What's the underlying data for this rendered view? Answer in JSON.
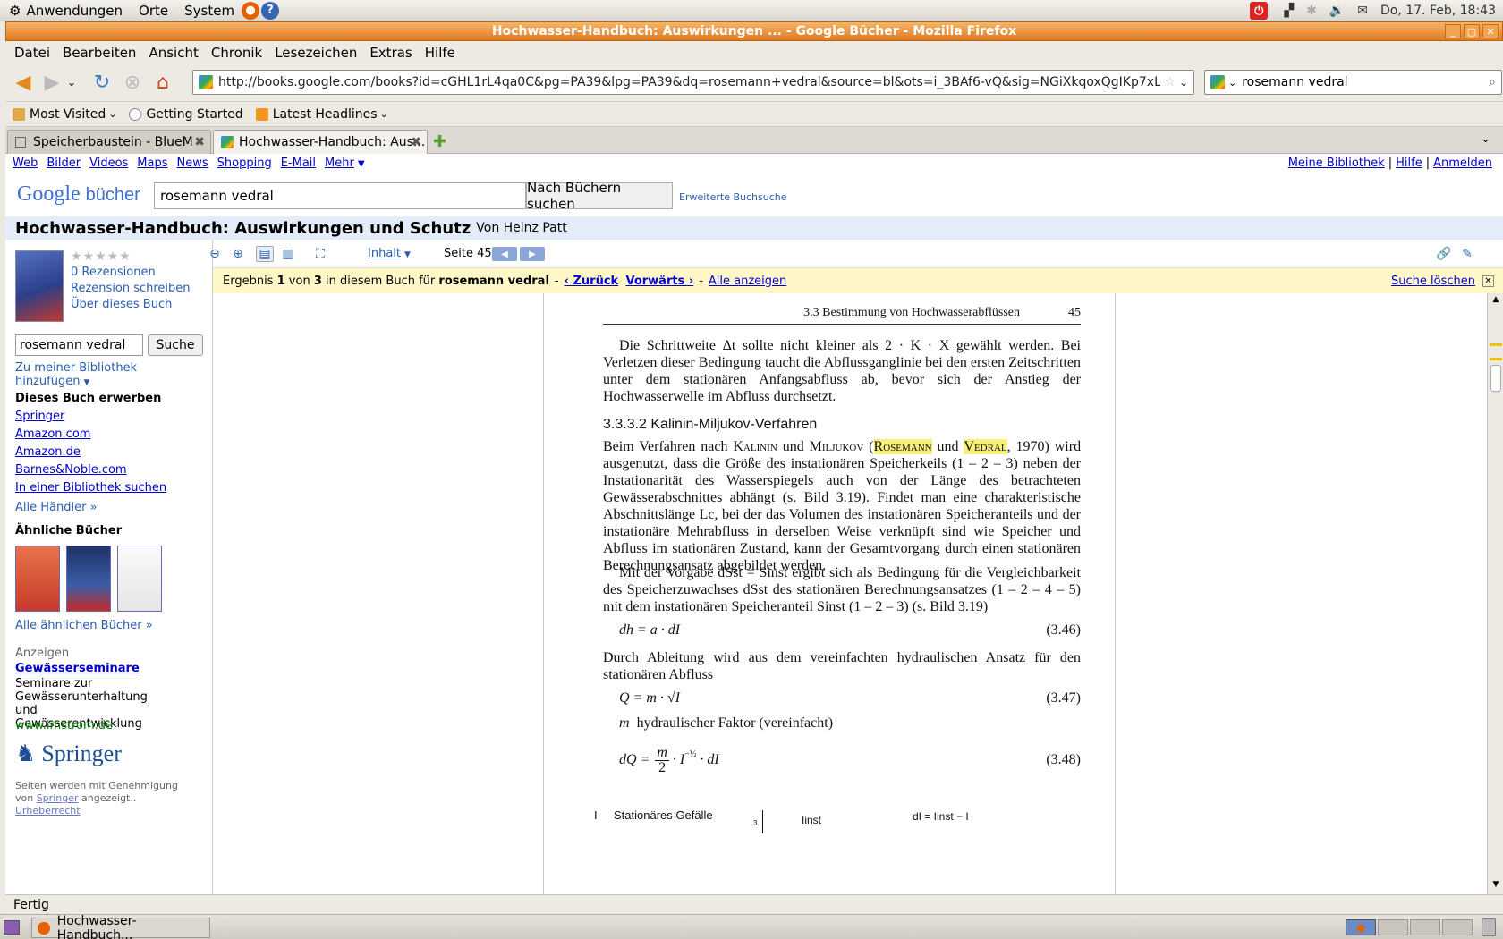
{
  "panel": {
    "apps": "Anwendungen",
    "places": "Orte",
    "system": "System",
    "clock": "Do, 17. Feb, 18:43"
  },
  "window": {
    "title": "Hochwasser-Handbuch: Auswirkungen ... - Google Bücher - Mozilla Firefox"
  },
  "menu": [
    "Datei",
    "Bearbeiten",
    "Ansicht",
    "Chronik",
    "Lesezeichen",
    "Extras",
    "Hilfe"
  ],
  "nav": {
    "url": "http://books.google.com/books?id=cGHL1rL4qa0C&pg=PA39&lpg=PA39&dq=rosemann+vedral&source=bl&ots=i_3BAf6-vQ&sig=NGiXkqoxQgIKp7xL-7BFjCE9F",
    "search_value": "rosemann vedral"
  },
  "bookmarks": [
    "Most Visited",
    "Getting Started",
    "Latest Headlines"
  ],
  "tabs": [
    {
      "label": "Speicherbaustein - BlueM"
    },
    {
      "label": "Hochwasser-Handbuch: Aus..."
    }
  ],
  "gbar": {
    "left": [
      "Web",
      "Bilder",
      "Videos",
      "Maps",
      "News",
      "Shopping",
      "E-Mail",
      "Mehr"
    ],
    "right": [
      "Meine Bibliothek",
      "Hilfe",
      "Anmelden"
    ]
  },
  "search": {
    "logo_google": "Google",
    "logo_books": "bücher",
    "query": "rosemann vedral",
    "submit": "Nach Büchern suchen",
    "advanced": "Erweiterte Buchsuche"
  },
  "book": {
    "title": "Hochwasser-Handbuch: Auswirkungen und Schutz",
    "author": "Von Heinz Patt"
  },
  "sidebar": {
    "rating_stars": "★★★★★",
    "reviews": "0 Rezensionen",
    "write_review": "Rezension schreiben",
    "about": "Über dieses Buch",
    "inbook_query": "rosemann vedral",
    "inbook_button": "Suche",
    "add_library": "Zu meiner Bibliothek hinzufügen",
    "buy_heading": "Dieses Buch erwerben",
    "sellers": [
      "Springer",
      "Amazon.com",
      "Amazon.de",
      "Barnes&Noble.com",
      "In einer Bibliothek suchen"
    ],
    "all_sellers": "Alle Händler »",
    "similar_heading": "Ähnliche Bücher",
    "all_similar": "Alle ähnlichen Bücher »",
    "ads_label": "Anzeigen",
    "ad_title": "Gewässerseminare",
    "ad_text": "Seminare zur Gewässerunterhaltung und Gewässerentwicklung",
    "ad_url": "www.imstrom.de",
    "publisher_logo": "Springer",
    "permission_1": "Seiten werden mit Genehmigung von",
    "permission_link": "Springer",
    "permission_2": "angezeigt..",
    "copyright": "Urheberrecht"
  },
  "viewer": {
    "contents": "Inhalt",
    "page_label": "Seite 45"
  },
  "result": {
    "prefix": "Ergebnis",
    "index": "1",
    "of": "von",
    "total": "3",
    "mid": "in diesem Buch für",
    "query": "rosemann vedral",
    "back": "‹ Zurück",
    "forward": "Vorwärts ›",
    "all": "Alle anzeigen",
    "clear": "Suche löschen"
  },
  "page": {
    "running_head": "3.3  Bestimmung von Hochwasserabflüssen",
    "page_number": "45",
    "p1": "Die Schrittweite Δt sollte nicht kleiner als 2 · K · X gewählt werden. Bei Verletzen dieser Bedingung taucht die Abflussganglinie bei den ersten Zeitschritten unter dem stationären Anfangsabfluss ab, bevor sich der Anstieg der Hochwasserwelle im Abfluss durchsetzt.",
    "heading": "3.3.3.2  Kalinin-Miljukov-Verfahren",
    "p2_a": "Beim Verfahren nach",
    "kalinin": "Kalinin",
    "und1": "und",
    "miljukov": "Miljukov",
    "rosemann": "Rosemann",
    "und2": "und",
    "vedral": "Vedral",
    "p2_b": "1970) wird ausgenutzt, dass die Größe des instationären Speicherkeils (1 – 2 – 3) neben der Instationarität des Wasserspiegels auch von der Länge des betrachteten Gewässerabschnittes abhängt (s. Bild 3.19). Findet man eine charakteristische Abschnittslänge Lc, bei der das Volumen des instationären Speicheranteils und der instationäre Mehrabfluss in derselben Weise verknüpft sind wie Speicher und Abfluss im stationären Zustand, kann der Gesamtvorgang durch einen stationären Berechnungsansatz abgebildet werden.",
    "p3": "Mit der Vorgabe dSst = Sinst ergibt sich als Bedingung für die Vergleichbarkeit des Speicherzuwachses dSst des stationären Berechnungsansatzes (1 – 2 – 4 – 5) mit dem instationären Speicheranteil Sinst (1 – 2 – 3) (s. Bild 3.19)",
    "eq1": "dh = a · dI",
    "eq1_num": "(3.46)",
    "p4": "Durch Ableitung wird aus dem vereinfachten hydraulischen Ansatz für den stationären Abfluss",
    "eq2": "Q = m · √I",
    "eq2_num": "(3.47)",
    "eq2_note_var": "m",
    "eq2_note": "hydraulischer Faktor (vereinfacht)",
    "eq3_lhs": "dQ =",
    "eq3_num_m": "m",
    "eq3_den": "2",
    "eq3_rest": "· I",
    "eq3_exp": "−½",
    "eq3_tail": "· dI",
    "eq3_num": "(3.48)",
    "fig_l": "I",
    "fig_caption": "Stationäres Gefälle",
    "fig_axis": "3",
    "fig_inst": "Iinst",
    "fig_dI": "dI = Iinst − I"
  },
  "status": {
    "text": "Fertig"
  },
  "taskbar": {
    "item": "Hochwasser-Handbuch..."
  }
}
